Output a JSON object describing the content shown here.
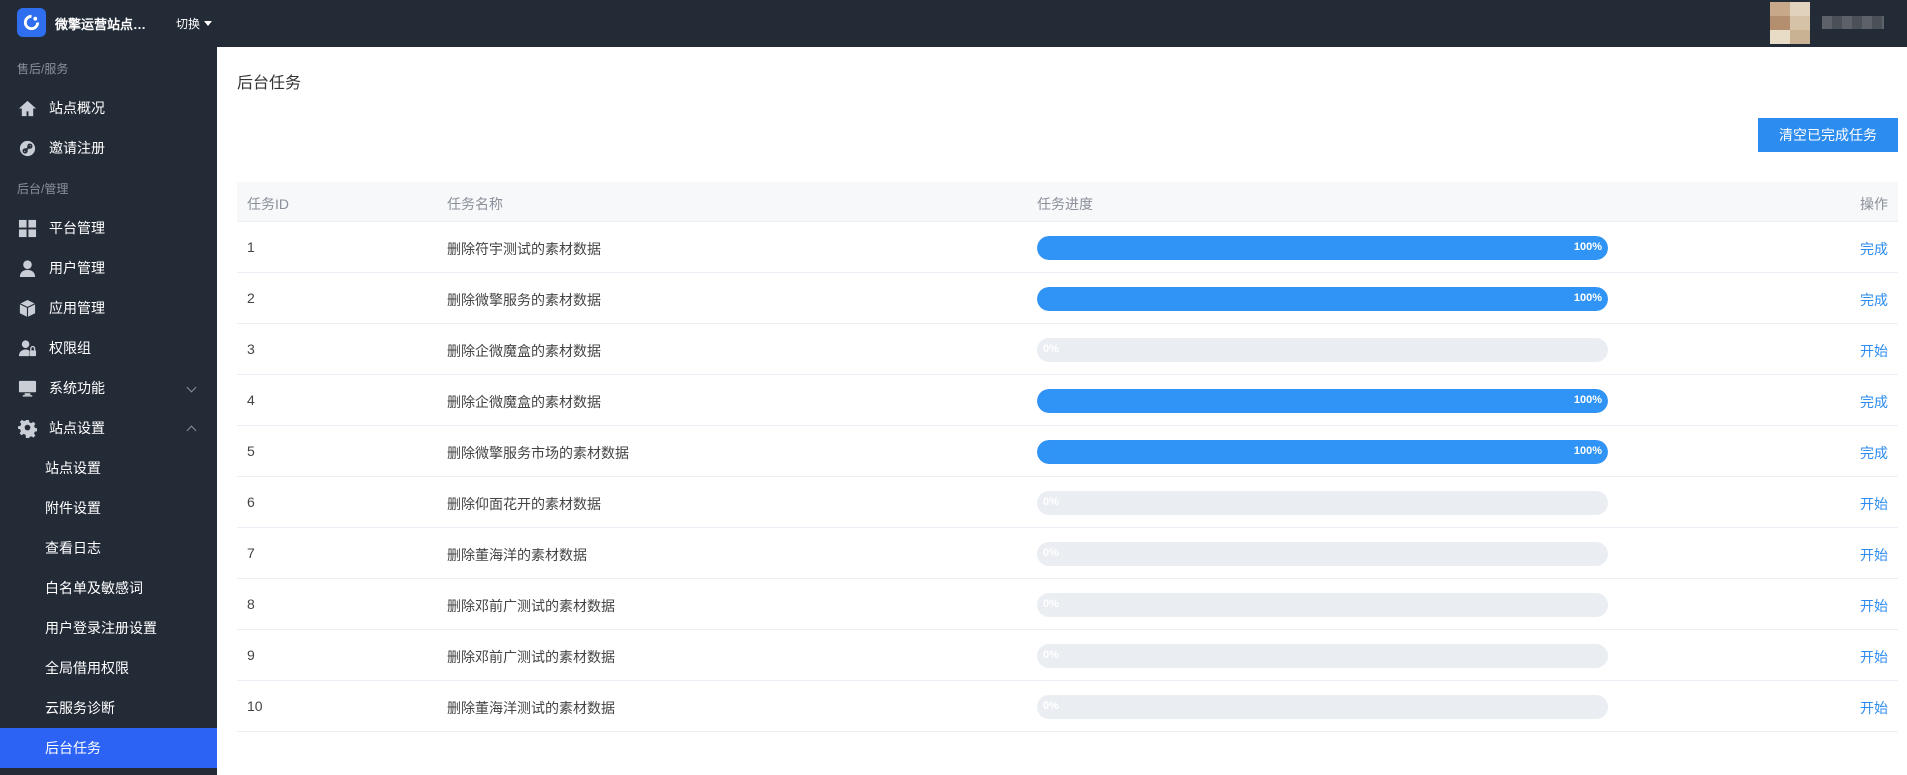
{
  "header": {
    "site_name": "微擎运营站点…",
    "switch_label": "切换",
    "avatar_colors": [
      "#c7a98a",
      "#e0d2bd",
      "#b38f6f",
      "#d6c2a6",
      "#e9dcc7",
      "#c9b293"
    ]
  },
  "sidebar": {
    "group1": "售后/服务",
    "group2": "后台/管理",
    "items": [
      {
        "label": "站点概况",
        "icon": "home-icon"
      },
      {
        "label": "邀请注册",
        "icon": "link-icon"
      },
      {
        "label": "平台管理",
        "icon": "grid-icon"
      },
      {
        "label": "用户管理",
        "icon": "user-icon"
      },
      {
        "label": "应用管理",
        "icon": "cube-icon"
      },
      {
        "label": "权限组",
        "icon": "user-lock-icon"
      },
      {
        "label": "系统功能",
        "icon": "monitor-icon"
      },
      {
        "label": "站点设置",
        "icon": "gear-icon"
      }
    ],
    "sub_items": [
      "站点设置",
      "附件设置",
      "查看日志",
      "白名单及敏感词",
      "用户登录注册设置",
      "全局借用权限",
      "云服务诊断",
      "后台任务"
    ],
    "active_sub": "后台任务"
  },
  "main": {
    "title": "后台任务",
    "clear_button": "清空已完成任务",
    "table": {
      "headers": {
        "id": "任务ID",
        "name": "任务名称",
        "progress": "任务进度",
        "op": "操作"
      },
      "rows": [
        {
          "id": "1",
          "name": "删除符宇测试的素材数据",
          "progress": 100,
          "progress_label": "100%",
          "op": "完成"
        },
        {
          "id": "2",
          "name": "删除微擎服务的素材数据",
          "progress": 100,
          "progress_label": "100%",
          "op": "完成"
        },
        {
          "id": "3",
          "name": "删除企微魔盒的素材数据",
          "progress": 0,
          "progress_label": "0%",
          "op": "开始"
        },
        {
          "id": "4",
          "name": "删除企微魔盒的素材数据",
          "progress": 100,
          "progress_label": "100%",
          "op": "完成"
        },
        {
          "id": "5",
          "name": "删除微擎服务市场的素材数据",
          "progress": 100,
          "progress_label": "100%",
          "op": "完成"
        },
        {
          "id": "6",
          "name": "删除仰面花开的素材数据",
          "progress": 0,
          "progress_label": "0%",
          "op": "开始"
        },
        {
          "id": "7",
          "name": "删除董海洋的素材数据",
          "progress": 0,
          "progress_label": "0%",
          "op": "开始"
        },
        {
          "id": "8",
          "name": "删除邓前广测试的素材数据",
          "progress": 0,
          "progress_label": "0%",
          "op": "开始"
        },
        {
          "id": "9",
          "name": "删除邓前广测试的素材数据",
          "progress": 0,
          "progress_label": "0%",
          "op": "开始"
        },
        {
          "id": "10",
          "name": "删除董海洋测试的素材数据",
          "progress": 0,
          "progress_label": "0%",
          "op": "开始"
        }
      ]
    }
  },
  "colors": {
    "accent": "#2d8cf0",
    "active_menu": "#2c63f5",
    "sidebar_bg": "#232b37"
  }
}
